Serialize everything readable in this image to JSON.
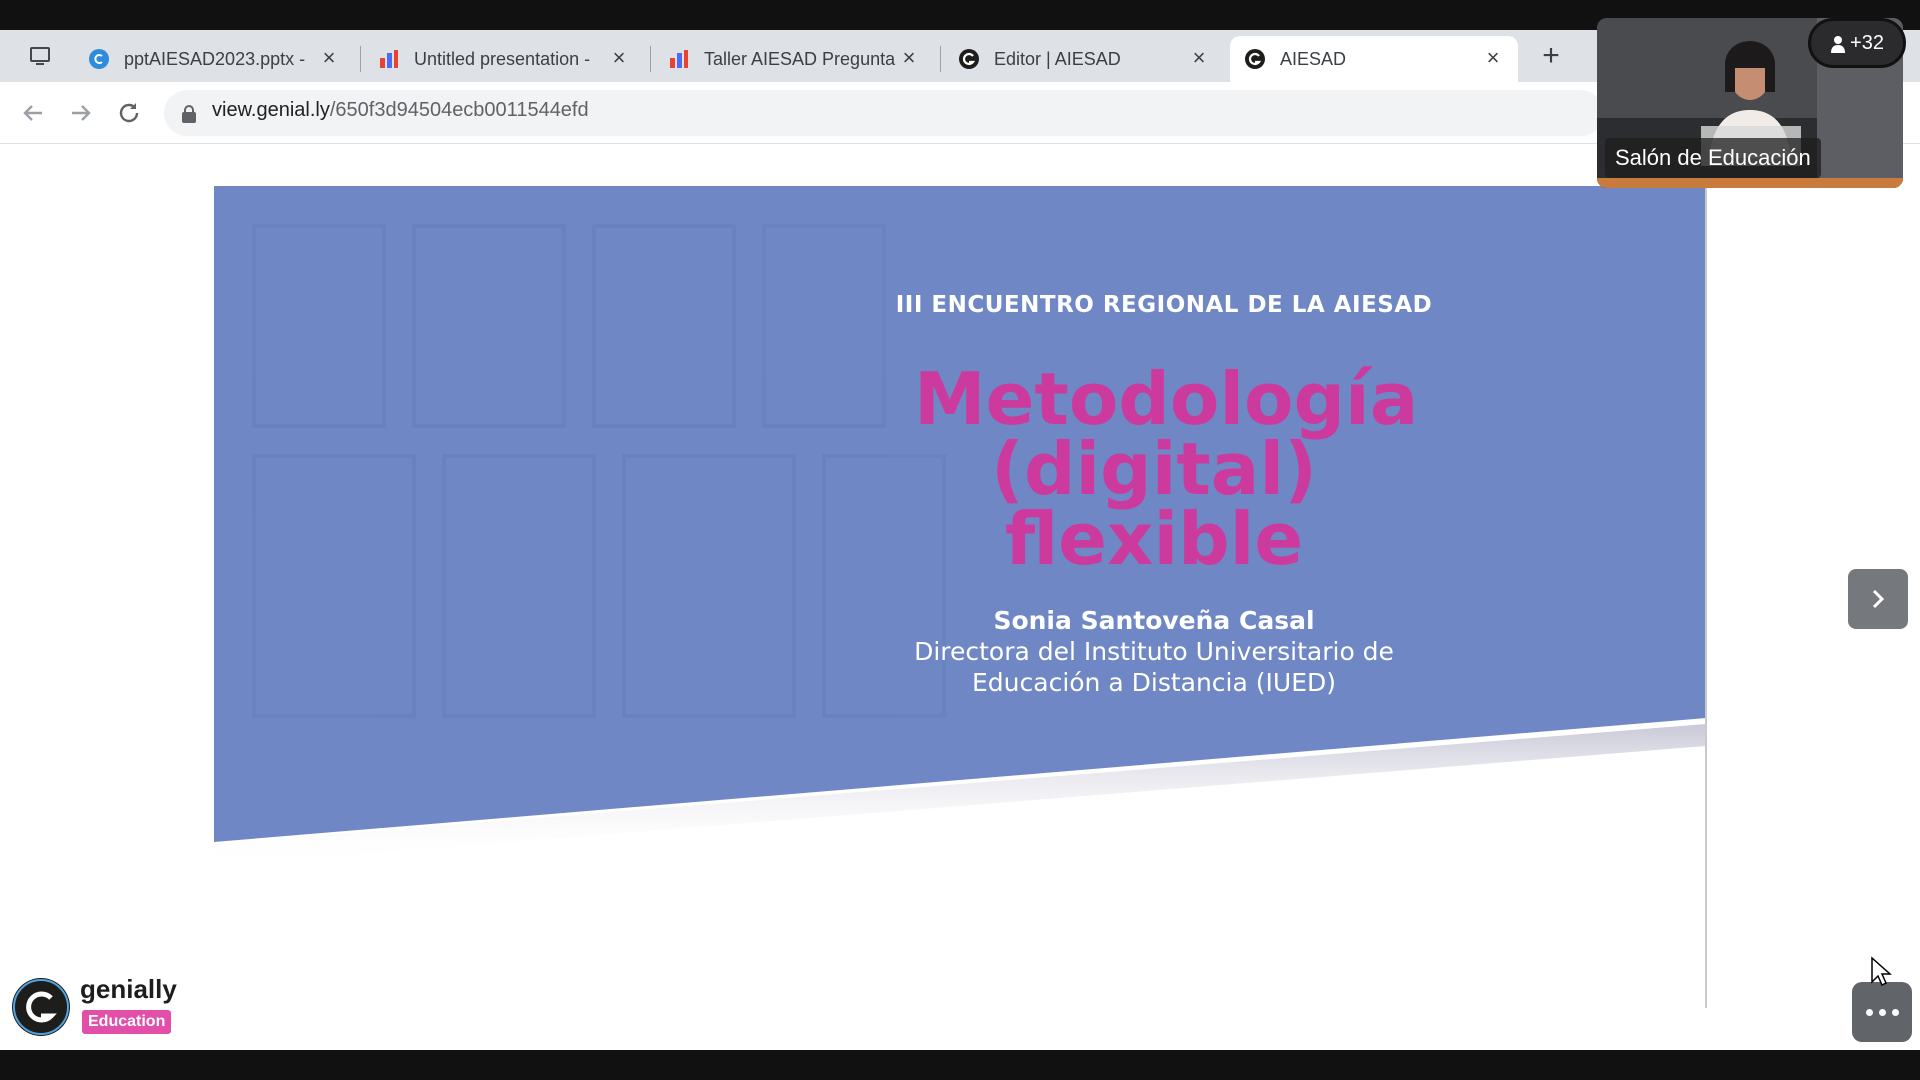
{
  "browser": {
    "tabs": [
      {
        "title": "pptAIESAD2023.pptx - ",
        "favicon": "canva-icon",
        "active": false
      },
      {
        "title": "Untitled presentation - ",
        "favicon": "chart-icon",
        "active": false
      },
      {
        "title": "Taller AIESAD Pregunta",
        "favicon": "chart-icon",
        "active": false
      },
      {
        "title": "Editor | AIESAD",
        "favicon": "genially-icon",
        "active": false
      },
      {
        "title": "AIESAD",
        "favicon": "genially-icon",
        "active": true
      }
    ],
    "url_host": "view.genial.ly",
    "url_path": "/650f3d94504ecb0011544efd"
  },
  "slide": {
    "subtitle": "III ENCUENTRO REGIONAL DE LA AIESAD",
    "title_lines": [
      "Metodología",
      "(digital)",
      "flexible"
    ],
    "author": "Sonia Santoveña Casal",
    "role_line1": "Directora del Instituto Universitario de",
    "role_line2": "Educación a Distancia (IUED)",
    "colors": {
      "background": "#6f87c4",
      "title": "#cd3a9d",
      "text": "#ffffff"
    }
  },
  "branding": {
    "name": "genially",
    "badge": "Education"
  },
  "video_call": {
    "speaker_label": "Salón de Educación",
    "participants_count": "+32"
  }
}
